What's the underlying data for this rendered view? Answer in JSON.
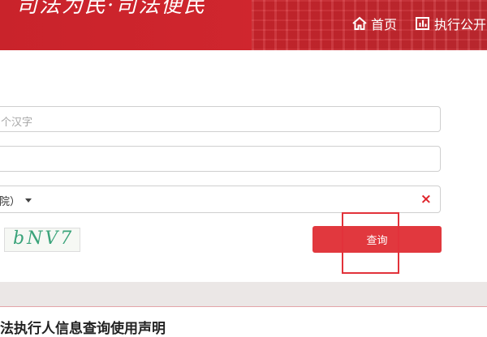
{
  "header": {
    "slogan": "司法为民·司法便民",
    "nav": [
      {
        "label": "首页",
        "icon": "home-icon"
      },
      {
        "label": "执行公开",
        "icon": "bar-chart-icon"
      }
    ]
  },
  "form": {
    "name_placeholder": "个汉字",
    "id_value": "",
    "court_select_value": "院）",
    "clear_symbol": "×",
    "captcha_text": "bNV7",
    "query_label": "查询"
  },
  "footer": {
    "title": "法执行人信息查询使用声明"
  },
  "colors": {
    "header_red": "#c9232b",
    "button_red": "#e1383e",
    "clear_red": "#e0262d"
  }
}
